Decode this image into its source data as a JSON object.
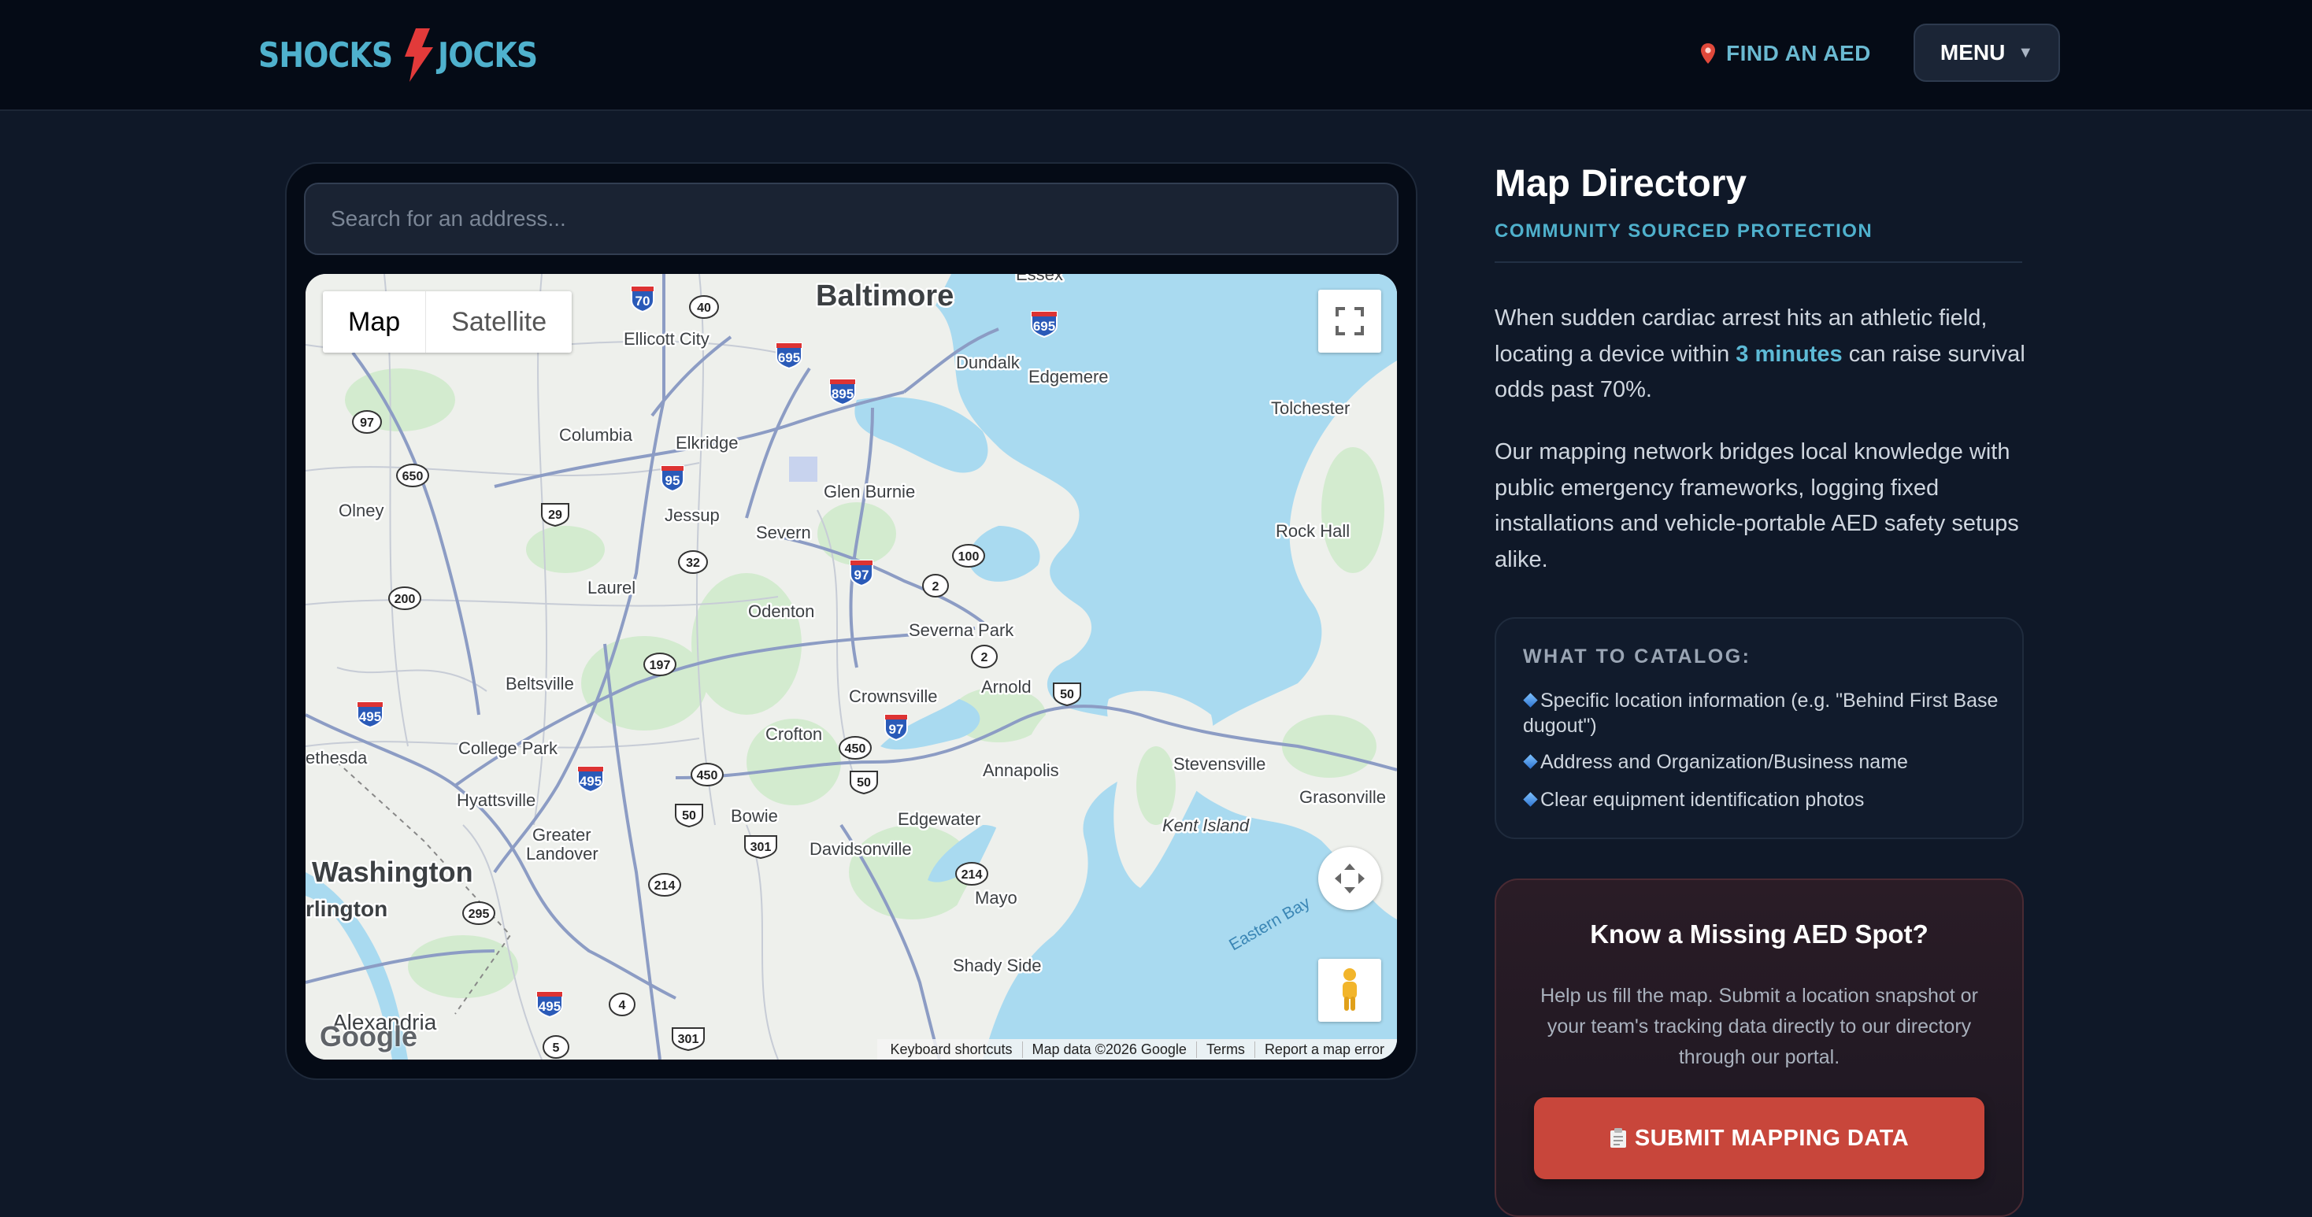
{
  "header": {
    "logo_left": "SHOCKS",
    "logo_right": "JOCKS",
    "find_aed": "FIND AN AED",
    "menu": "MENU",
    "menu_caret": "▼"
  },
  "map": {
    "search_placeholder": "Search for an address...",
    "type_map": "Map",
    "type_satellite": "Satellite",
    "google": "Google",
    "attribution": {
      "shortcuts": "Keyboard shortcuts",
      "data": "Map data ©2026 Google",
      "terms": "Terms",
      "report": "Report a map error"
    },
    "places": {
      "baltimore": "Baltimore",
      "essex": "Essex",
      "ellicott_city": "Ellicott City",
      "dundalk": "Dundalk",
      "edgemere": "Edgemere",
      "tolchester": "Tolchester",
      "columbia": "Columbia",
      "elkridge": "Elkridge",
      "glen_burnie": "Glen Burnie",
      "olney": "Olney",
      "jessup": "Jessup",
      "severn": "Severn",
      "rock_hall": "Rock Hall",
      "laurel": "Laurel",
      "odenton": "Odenton",
      "severna_park": "Severna Park",
      "beltsville": "Beltsville",
      "crownsville": "Crownsville",
      "arnold": "Arnold",
      "crofton": "Crofton",
      "bethesda": "ethesda",
      "college_park": "College Park",
      "annapolis": "Annapolis",
      "stevensville": "Stevensville",
      "hyattsville": "Hyattsville",
      "bowie": "Bowie",
      "grasonville": "Grasonville",
      "edgewater": "Edgewater",
      "greater": "Greater",
      "landover": "Landover",
      "kent_island": "Kent Island",
      "davidsonville": "Davidsonville",
      "washington": "Washington",
      "arlington": "rlington",
      "mayo": "Mayo",
      "eastern_bay": "Eastern Bay",
      "shady_side": "Shady Side",
      "alexandria": "Alexandria"
    },
    "shields": {
      "s70": "70",
      "s40": "40",
      "s695a": "695",
      "s695b": "695",
      "s895": "895",
      "s97a": "97",
      "s650": "650",
      "s95": "95",
      "s29": "29",
      "s32": "32",
      "s100": "100",
      "s97b": "97",
      "s2a": "2",
      "s200": "200",
      "s2b": "2",
      "s197": "197",
      "s50a": "50",
      "s97c": "97",
      "s495a": "495",
      "s450a": "450",
      "s450b": "450",
      "s50b": "50",
      "s495b": "495",
      "s50c": "50",
      "s301a": "301",
      "s214a": "214",
      "s214b": "214",
      "s295": "295",
      "s495c": "495",
      "s4": "4",
      "s301b": "301",
      "s5": "5"
    }
  },
  "directory": {
    "title": "Map Directory",
    "subtitle": "COMMUNITY SOURCED PROTECTION",
    "para1_a": "When sudden cardiac arrest hits an athletic field, locating a device within ",
    "para1_highlight": "3 minutes",
    "para1_b": " can raise survival odds past 70%.",
    "para2": "Our mapping network bridges local knowledge with public emergency frameworks, logging fixed installations and vehicle-portable AED safety setups alike.",
    "catalog_heading": "WHAT TO CATALOG:",
    "catalog_items": [
      "Specific location information (e.g. \"Behind First Base dugout\")",
      "Address and Organization/Business name",
      "Clear equipment identification photos"
    ]
  },
  "cta": {
    "title": "Know a Missing AED Spot?",
    "text": "Help us fill the map. Submit a location snapshot or your team's tracking data directly to our directory through our portal.",
    "button": "SUBMIT MAPPING DATA"
  },
  "colors": {
    "page_bg": "#0f1828",
    "header_bg": "#050b16",
    "accent_cyan": "#4fb1cd",
    "accent_red": "#c8463b",
    "water": "#a8d9ef",
    "park": "#d5ecd0",
    "road": "#8a9ac0"
  },
  "icons": [
    "lightning-bolt-icon",
    "map-pin-icon",
    "chevron-down-icon",
    "fullscreen-icon",
    "pan-arrows-icon",
    "pegman-icon",
    "diamond-bullet-icon",
    "clipboard-icon"
  ]
}
